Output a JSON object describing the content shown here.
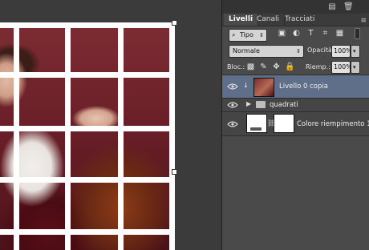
{
  "panel": {
    "tabs": [
      "Livelli",
      "Canali",
      "Tracciati"
    ],
    "filter": {
      "label": "Tipo"
    },
    "blend_mode": "Normale",
    "opacity": {
      "label": "Opacità:",
      "value": "100%"
    },
    "lock": {
      "label": "Bloc.:"
    },
    "fill": {
      "label": "Riemp.:",
      "value": "100%"
    },
    "layers": [
      {
        "name": "Livello 0 copia",
        "selected": true
      },
      {
        "name": "quadrati"
      },
      {
        "name": "Colore riempimento 1"
      }
    ]
  },
  "colors": {
    "panel_bg": "#4a4a4a",
    "selected_row": "#5f6f8a",
    "grid": "#ffffff"
  }
}
